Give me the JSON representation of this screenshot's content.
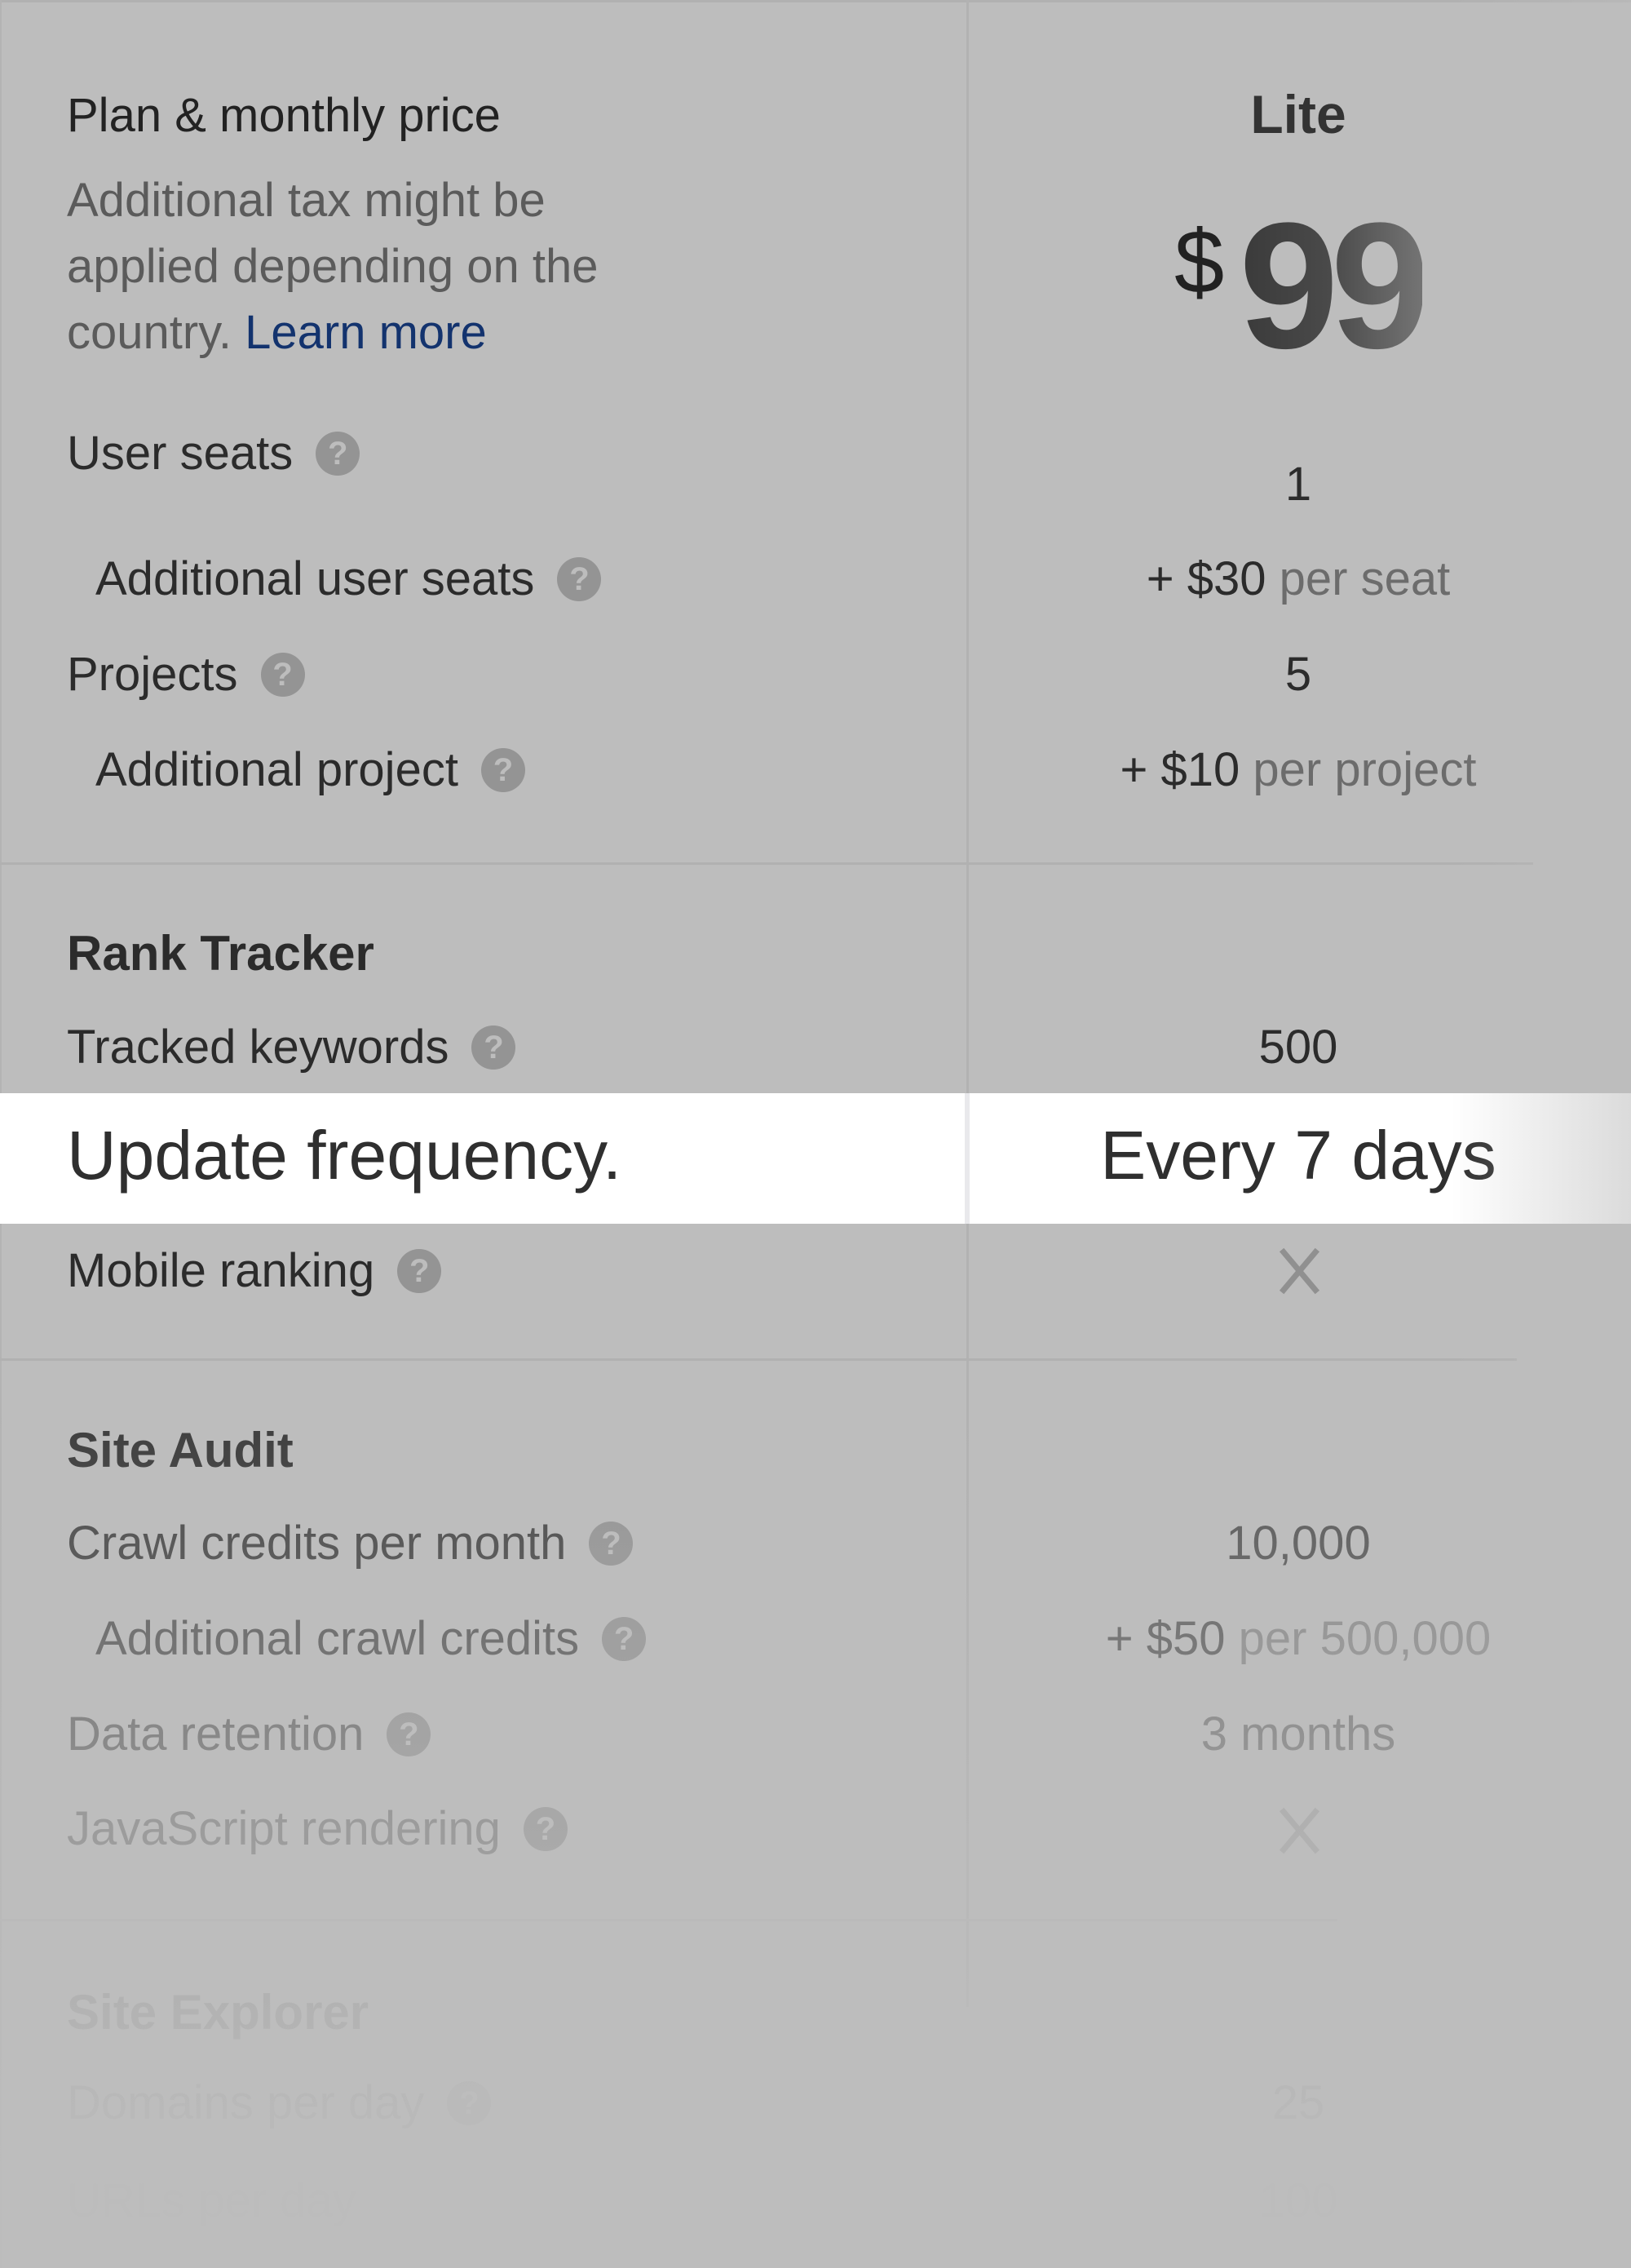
{
  "plan_header": {
    "label": "Plan & monthly price",
    "note": "Additional tax might be applied depending on the country.",
    "learn_more": "Learn more",
    "plan_name": "Lite",
    "currency": "$",
    "price": "99"
  },
  "general": {
    "rows": [
      {
        "label": "User seats",
        "value": "1",
        "help": true,
        "sub": false
      },
      {
        "label": "Additional user seats",
        "value_main": "+ $30",
        "value_unit": "per seat",
        "help": true,
        "sub": true
      },
      {
        "label": "Projects",
        "value": "5",
        "help": true,
        "sub": false
      },
      {
        "label": "Additional project",
        "value_main": "+ $10",
        "value_unit": "per project",
        "help": true,
        "sub": true
      }
    ]
  },
  "rank_tracker": {
    "title": "Rank Tracker",
    "rows": [
      {
        "label": "Tracked keywords",
        "value": "500",
        "help": true
      },
      {
        "label": "Update frequency.",
        "value": "Every 7 days",
        "highlighted": true
      },
      {
        "label": "Mobile ranking",
        "value": "not-included",
        "icon": "cross-icon",
        "help": true
      }
    ]
  },
  "site_audit": {
    "title": "Site Audit",
    "rows": [
      {
        "label": "Crawl credits per month",
        "value": "10,000",
        "help": true
      },
      {
        "label": "Additional crawl credits",
        "value_main": "+ $50",
        "value_unit": "per 500,000",
        "help": true,
        "sub": true
      },
      {
        "label": "Data retention",
        "value": "3 months",
        "help": true
      },
      {
        "label": "JavaScript rendering",
        "value": "not-included",
        "icon": "cross-icon",
        "help": true
      }
    ]
  },
  "site_explorer": {
    "title": "Site Explorer",
    "rows": [
      {
        "label": "Domains per day",
        "value": "25",
        "help": true
      },
      {
        "label": "URLs per day",
        "value": "100"
      }
    ]
  },
  "help_glyph": "?",
  "colors": {
    "background": "#bdbdbd",
    "highlight": "#ffffff",
    "link": "#13336e",
    "help_icon": "#949494"
  }
}
